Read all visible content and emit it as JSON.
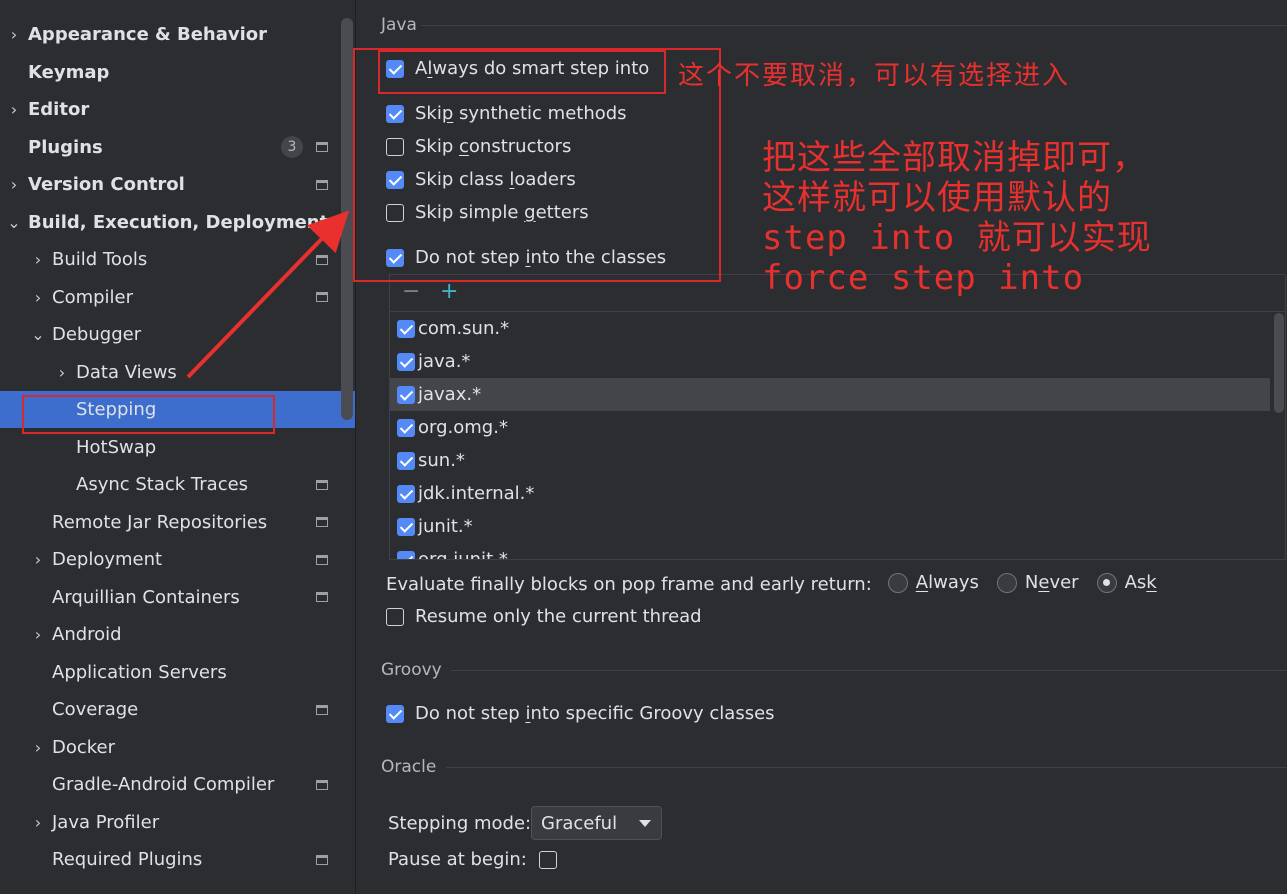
{
  "sidebar": {
    "items": [
      {
        "label": "Appearance & Behavior",
        "arrow": "›",
        "bold": true
      },
      {
        "label": "Keymap",
        "arrow": "",
        "bold": true
      },
      {
        "label": "Editor",
        "arrow": "›",
        "bold": true
      },
      {
        "label": "Plugins",
        "arrow": "",
        "bold": true,
        "badge": "3"
      },
      {
        "label": "Version Control",
        "arrow": "›",
        "bold": true
      },
      {
        "label": "Build, Execution, Deployment",
        "arrow": "⌄",
        "bold": true
      },
      {
        "label": "Build Tools",
        "arrow": "›"
      },
      {
        "label": "Compiler",
        "arrow": "›"
      },
      {
        "label": "Debugger",
        "arrow": "⌄"
      },
      {
        "label": "Data Views",
        "arrow": "›"
      },
      {
        "label": "Stepping",
        "arrow": "",
        "selected": true
      },
      {
        "label": "HotSwap",
        "arrow": ""
      },
      {
        "label": "Async Stack Traces",
        "arrow": ""
      },
      {
        "label": "Remote Jar Repositories",
        "arrow": ""
      },
      {
        "label": "Deployment",
        "arrow": "›"
      },
      {
        "label": "Arquillian Containers",
        "arrow": ""
      },
      {
        "label": "Android",
        "arrow": "›"
      },
      {
        "label": "Application Servers",
        "arrow": ""
      },
      {
        "label": "Coverage",
        "arrow": ""
      },
      {
        "label": "Docker",
        "arrow": "›"
      },
      {
        "label": "Gradle-Android Compiler",
        "arrow": ""
      },
      {
        "label": "Java Profiler",
        "arrow": "›"
      },
      {
        "label": "Required Plugins",
        "arrow": ""
      }
    ]
  },
  "java": {
    "title": "Java",
    "always_smart_step": {
      "pre": "A",
      "u": "l",
      "post": "ways do smart step into",
      "checked": true
    },
    "skip_synthetic": {
      "pre": "Ski",
      "u": "p",
      "post": " synthetic methods",
      "checked": true
    },
    "skip_constructors": {
      "pre": "Skip ",
      "u": "c",
      "post": "onstructors",
      "checked": false
    },
    "skip_class_loaders": {
      "pre": "Skip class ",
      "u": "l",
      "post": "oaders",
      "checked": true
    },
    "skip_simple_getters": {
      "pre": "Skip simple ",
      "u": "g",
      "post": "etters",
      "checked": false
    },
    "do_not_step_classes": {
      "pre": "Do not step ",
      "u": "i",
      "post": "nto the classes",
      "checked": true
    },
    "toolbar": {
      "remove": "−",
      "add": "+"
    },
    "filters": [
      "com.sun.*",
      "java.*",
      "javax.*",
      "org.omg.*",
      "sun.*",
      "jdk.internal.*",
      "junit.*",
      "org.junit.*"
    ],
    "evaluate_finally": {
      "label": "Evaluate finally blocks on pop frame and early return:",
      "options": [
        {
          "pre": "",
          "u": "A",
          "post": "lways",
          "checked": false
        },
        {
          "pre": "N",
          "u": "e",
          "post": "ver",
          "checked": false
        },
        {
          "pre": "As",
          "u": "k",
          "post": "",
          "checked": true
        }
      ]
    },
    "resume_only_current": {
      "label": "Resume only the current thread",
      "checked": false
    }
  },
  "groovy": {
    "title": "Groovy",
    "do_not_step_groovy": {
      "pre": "Do not step ",
      "u": "i",
      "post": "nto specific Groovy classes",
      "checked": true
    }
  },
  "oracle": {
    "title": "Oracle",
    "stepping_mode_label": "Stepping mode:",
    "stepping_mode_value": "Graceful",
    "pause_at_begin_label": "Pause at begin:",
    "pause_at_begin_checked": false
  },
  "annotations": {
    "note1": "这个不要取消，可以有选择进入",
    "note2": [
      "把这些全部取消掉即可，",
      "这样就可以使用默认的",
      "step into 就可以实现",
      "force step into"
    ],
    "color": "#e8302e"
  },
  "colors": {
    "accent": "#548af7",
    "selection": "#3d6ece",
    "background": "#2b2d30"
  }
}
